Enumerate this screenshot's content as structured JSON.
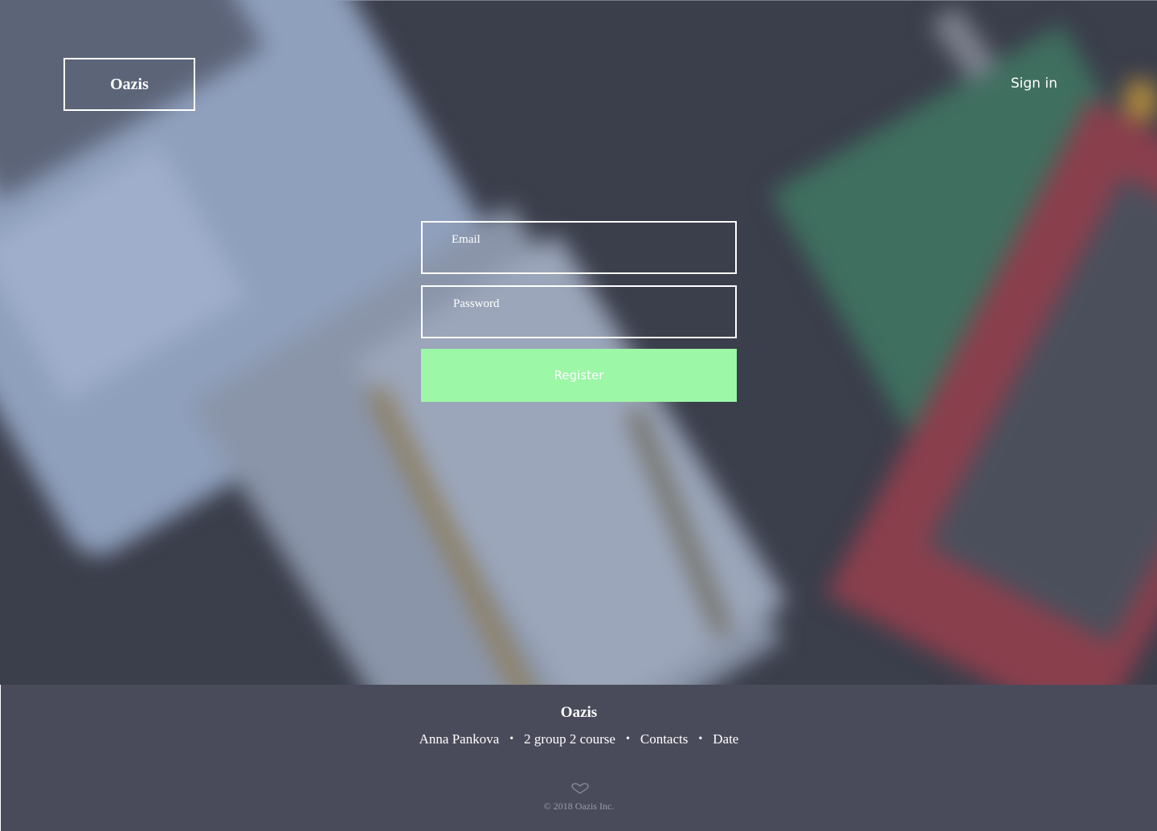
{
  "header": {
    "logo": "Oazis",
    "signin_label": "Sign in"
  },
  "form": {
    "email_placeholder": "Email",
    "password_placeholder": "Password",
    "register_label": "Register"
  },
  "colors": {
    "register_button": "#9cf7a7",
    "footer_bg": "#4a4b5a",
    "overlay": "#3b3e4b"
  },
  "footer": {
    "title": "Oazis",
    "links": [
      "Anna Pankova",
      "2 group 2 course",
      "Contacts",
      "Date"
    ],
    "separator": "•",
    "icon": "heart-icon",
    "copyright": "© 2018 Oazis Inc."
  }
}
